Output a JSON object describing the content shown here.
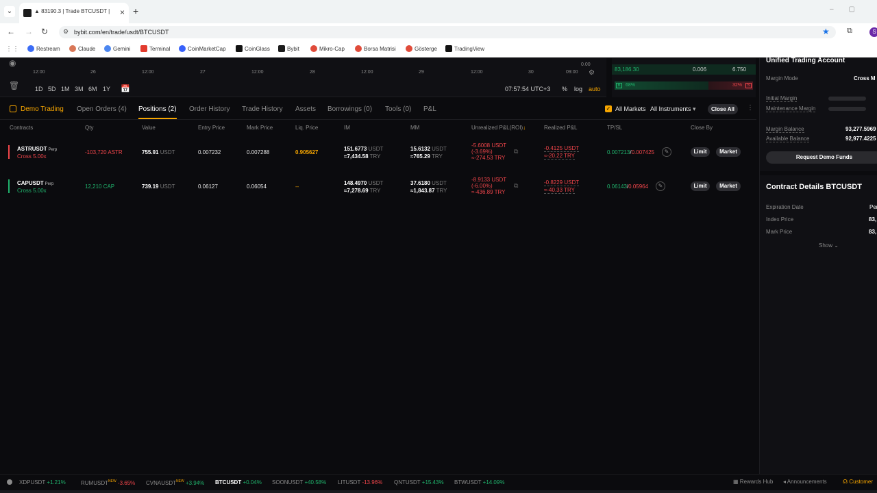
{
  "browser": {
    "tab_title": "▲ 83190.3 | Trade BTCUSDT | By",
    "url": "bybit.com/en/trade/usdt/BTCUSDT",
    "profile_initial": "S",
    "bookmarks": [
      "Restream",
      "Claude",
      "Gemini",
      "Terminal",
      "CoinMarketCap",
      "CoinGlass",
      "Bybit",
      "Mikro-Cap",
      "Borsa Matrisi",
      "Gösterge",
      "TradingView"
    ]
  },
  "chart": {
    "x_ticks": [
      "12:00",
      "26",
      "12:00",
      "27",
      "12:00",
      "28",
      "12:00",
      "29",
      "12:00",
      "30",
      "09:00"
    ],
    "timeframes": [
      "1D",
      "5D",
      "1M",
      "3M",
      "6M",
      "1Y"
    ],
    "clock": "07:57:54 UTC+3",
    "ctl_percent": "%",
    "ctl_log": "log",
    "ctl_auto": "auto",
    "price_axis_label": "0.00"
  },
  "orderbook": {
    "rows": [
      {
        "price": "83,186.30",
        "qty": "0.006",
        "total": "6.750"
      }
    ],
    "buy_pct": "68%",
    "sell_pct": "32%",
    "buy_ratio": 0.68,
    "buy_label": "B",
    "sell_label": "S"
  },
  "positions": {
    "tabs": {
      "demo": "Demo Trading",
      "open_orders": "Open Orders (4)",
      "positions": "Positions (2)",
      "order_history": "Order History",
      "trade_history": "Trade History",
      "assets": "Assets",
      "borrowings": "Borrowings (0)",
      "tools": "Tools (0)",
      "pnl": "P&L"
    },
    "all_markets": "All Markets",
    "all_instruments": "All Instruments",
    "close_all": "Close All",
    "headers": {
      "contracts": "Contracts",
      "qty": "Qty",
      "value": "Value",
      "entry": "Entry Price",
      "mark": "Mark Price",
      "liq": "Liq. Price",
      "im": "IM",
      "mm": "MM",
      "upnl": "Unrealized P&L(ROI)",
      "rpnl": "Realized P&L",
      "tpsl": "TP/SL",
      "close_by": "Close By"
    },
    "rows": [
      {
        "symbol": "ASTRUSDT",
        "perp": "Perp",
        "leverage": "Cross 5.00x",
        "side": "short",
        "qty": "-103,720 ASTR",
        "value": "755.91",
        "value_unit": "USDT",
        "entry": "0.007232",
        "mark": "0.007288",
        "liq": "0.905627",
        "im": "151.6773",
        "im_unit": "USDT",
        "im_try": "≈7,434.58",
        "im_try_unit": "TRY",
        "mm": "15.6132",
        "mm_unit": "USDT",
        "mm_try": "≈765.29",
        "mm_try_unit": "TRY",
        "upnl": "-5.6008 USDT",
        "upnl_roi": "(-3.69%)",
        "upnl_try": "≈-274.53 TRY",
        "rpnl": "-0.4125 USDT",
        "rpnl_try": "≈-20.22 TRY",
        "tp": "0.007213",
        "sl": "0.007425",
        "limit": "Limit",
        "market": "Market"
      },
      {
        "symbol": "CAPUSDT",
        "perp": "Perp",
        "leverage": "Cross 5.00x",
        "side": "long",
        "qty": "12,210 CAP",
        "value": "739.19",
        "value_unit": "USDT",
        "entry": "0.06127",
        "mark": "0.06054",
        "liq": "--",
        "im": "148.4970",
        "im_unit": "USDT",
        "im_try": "≈7,278.69",
        "im_try_unit": "TRY",
        "mm": "37.6180",
        "mm_unit": "USDT",
        "mm_try": "≈1,843.87",
        "mm_try_unit": "TRY",
        "upnl": "-8.9133 USDT",
        "upnl_roi": "(-6.00%)",
        "upnl_try": "≈-436.89 TRY",
        "rpnl": "-0.8229 USDT",
        "rpnl_try": "≈-40.33 TRY",
        "tp": "0.06143",
        "sl": "0.05964",
        "limit": "Limit",
        "market": "Market"
      }
    ]
  },
  "account": {
    "title": "Unified Trading Account",
    "margin_mode_label": "Margin Mode",
    "margin_mode_value": "Cross M",
    "initial_margin": "Initial Margin",
    "maintenance_margin": "Maintenance Margin",
    "margin_balance_label": "Margin Balance",
    "margin_balance_value": "93,277.5969",
    "available_balance_label": "Available Balance",
    "available_balance_value": "92,977.4225",
    "request_funds": "Request Demo Funds",
    "contract_title": "Contract Details BTCUSDT",
    "expiration_label": "Expiration Date",
    "expiration_value": "Per",
    "index_label": "Index Price",
    "index_value": "83,",
    "mark_label": "Mark Price",
    "mark_value": "83,",
    "show": "Show"
  },
  "ticker": {
    "items": [
      {
        "sym": "XDPUSDT",
        "chg": "+1.21%",
        "up": true,
        "new": false
      },
      {
        "sym": "RUMUSDT",
        "chg": "-3.65%",
        "up": false,
        "new": true
      },
      {
        "sym": "CVNAUSDT",
        "chg": "+3.94%",
        "up": true,
        "new": true
      },
      {
        "sym": "BTCUSDT",
        "chg": "+0.04%",
        "up": true,
        "new": false
      },
      {
        "sym": "SOONUSDT",
        "chg": "+40.58%",
        "up": true,
        "new": false
      },
      {
        "sym": "LITUSDT",
        "chg": "-13.96%",
        "up": false,
        "new": false
      },
      {
        "sym": "QNTUSDT",
        "chg": "+15.43%",
        "up": true,
        "new": false
      },
      {
        "sym": "BTWUSDT",
        "chg": "+14.09%",
        "up": true,
        "new": false
      }
    ],
    "new_label": "NEW",
    "rewards": "Rewards Hub",
    "announcements": "Announcements",
    "customer": "Customer"
  },
  "colors": {
    "accent": "#f7a600",
    "up": "#20b26c",
    "down": "#ef454a"
  }
}
